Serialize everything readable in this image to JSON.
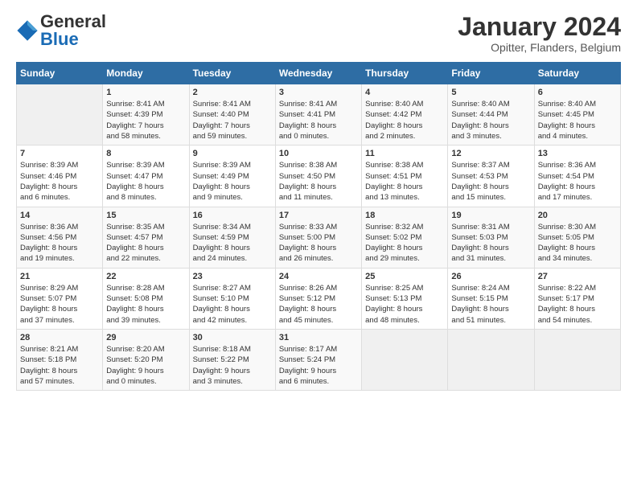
{
  "logo": {
    "general": "General",
    "blue": "Blue"
  },
  "title": "January 2024",
  "location": "Opitter, Flanders, Belgium",
  "weekdays": [
    "Sunday",
    "Monday",
    "Tuesday",
    "Wednesday",
    "Thursday",
    "Friday",
    "Saturday"
  ],
  "weeks": [
    [
      {
        "day": "",
        "info": ""
      },
      {
        "day": "1",
        "info": "Sunrise: 8:41 AM\nSunset: 4:39 PM\nDaylight: 7 hours\nand 58 minutes."
      },
      {
        "day": "2",
        "info": "Sunrise: 8:41 AM\nSunset: 4:40 PM\nDaylight: 7 hours\nand 59 minutes."
      },
      {
        "day": "3",
        "info": "Sunrise: 8:41 AM\nSunset: 4:41 PM\nDaylight: 8 hours\nand 0 minutes."
      },
      {
        "day": "4",
        "info": "Sunrise: 8:40 AM\nSunset: 4:42 PM\nDaylight: 8 hours\nand 2 minutes."
      },
      {
        "day": "5",
        "info": "Sunrise: 8:40 AM\nSunset: 4:44 PM\nDaylight: 8 hours\nand 3 minutes."
      },
      {
        "day": "6",
        "info": "Sunrise: 8:40 AM\nSunset: 4:45 PM\nDaylight: 8 hours\nand 4 minutes."
      }
    ],
    [
      {
        "day": "7",
        "info": "Sunrise: 8:39 AM\nSunset: 4:46 PM\nDaylight: 8 hours\nand 6 minutes."
      },
      {
        "day": "8",
        "info": "Sunrise: 8:39 AM\nSunset: 4:47 PM\nDaylight: 8 hours\nand 8 minutes."
      },
      {
        "day": "9",
        "info": "Sunrise: 8:39 AM\nSunset: 4:49 PM\nDaylight: 8 hours\nand 9 minutes."
      },
      {
        "day": "10",
        "info": "Sunrise: 8:38 AM\nSunset: 4:50 PM\nDaylight: 8 hours\nand 11 minutes."
      },
      {
        "day": "11",
        "info": "Sunrise: 8:38 AM\nSunset: 4:51 PM\nDaylight: 8 hours\nand 13 minutes."
      },
      {
        "day": "12",
        "info": "Sunrise: 8:37 AM\nSunset: 4:53 PM\nDaylight: 8 hours\nand 15 minutes."
      },
      {
        "day": "13",
        "info": "Sunrise: 8:36 AM\nSunset: 4:54 PM\nDaylight: 8 hours\nand 17 minutes."
      }
    ],
    [
      {
        "day": "14",
        "info": "Sunrise: 8:36 AM\nSunset: 4:56 PM\nDaylight: 8 hours\nand 19 minutes."
      },
      {
        "day": "15",
        "info": "Sunrise: 8:35 AM\nSunset: 4:57 PM\nDaylight: 8 hours\nand 22 minutes."
      },
      {
        "day": "16",
        "info": "Sunrise: 8:34 AM\nSunset: 4:59 PM\nDaylight: 8 hours\nand 24 minutes."
      },
      {
        "day": "17",
        "info": "Sunrise: 8:33 AM\nSunset: 5:00 PM\nDaylight: 8 hours\nand 26 minutes."
      },
      {
        "day": "18",
        "info": "Sunrise: 8:32 AM\nSunset: 5:02 PM\nDaylight: 8 hours\nand 29 minutes."
      },
      {
        "day": "19",
        "info": "Sunrise: 8:31 AM\nSunset: 5:03 PM\nDaylight: 8 hours\nand 31 minutes."
      },
      {
        "day": "20",
        "info": "Sunrise: 8:30 AM\nSunset: 5:05 PM\nDaylight: 8 hours\nand 34 minutes."
      }
    ],
    [
      {
        "day": "21",
        "info": "Sunrise: 8:29 AM\nSunset: 5:07 PM\nDaylight: 8 hours\nand 37 minutes."
      },
      {
        "day": "22",
        "info": "Sunrise: 8:28 AM\nSunset: 5:08 PM\nDaylight: 8 hours\nand 39 minutes."
      },
      {
        "day": "23",
        "info": "Sunrise: 8:27 AM\nSunset: 5:10 PM\nDaylight: 8 hours\nand 42 minutes."
      },
      {
        "day": "24",
        "info": "Sunrise: 8:26 AM\nSunset: 5:12 PM\nDaylight: 8 hours\nand 45 minutes."
      },
      {
        "day": "25",
        "info": "Sunrise: 8:25 AM\nSunset: 5:13 PM\nDaylight: 8 hours\nand 48 minutes."
      },
      {
        "day": "26",
        "info": "Sunrise: 8:24 AM\nSunset: 5:15 PM\nDaylight: 8 hours\nand 51 minutes."
      },
      {
        "day": "27",
        "info": "Sunrise: 8:22 AM\nSunset: 5:17 PM\nDaylight: 8 hours\nand 54 minutes."
      }
    ],
    [
      {
        "day": "28",
        "info": "Sunrise: 8:21 AM\nSunset: 5:18 PM\nDaylight: 8 hours\nand 57 minutes."
      },
      {
        "day": "29",
        "info": "Sunrise: 8:20 AM\nSunset: 5:20 PM\nDaylight: 9 hours\nand 0 minutes."
      },
      {
        "day": "30",
        "info": "Sunrise: 8:18 AM\nSunset: 5:22 PM\nDaylight: 9 hours\nand 3 minutes."
      },
      {
        "day": "31",
        "info": "Sunrise: 8:17 AM\nSunset: 5:24 PM\nDaylight: 9 hours\nand 6 minutes."
      },
      {
        "day": "",
        "info": ""
      },
      {
        "day": "",
        "info": ""
      },
      {
        "day": "",
        "info": ""
      }
    ]
  ]
}
